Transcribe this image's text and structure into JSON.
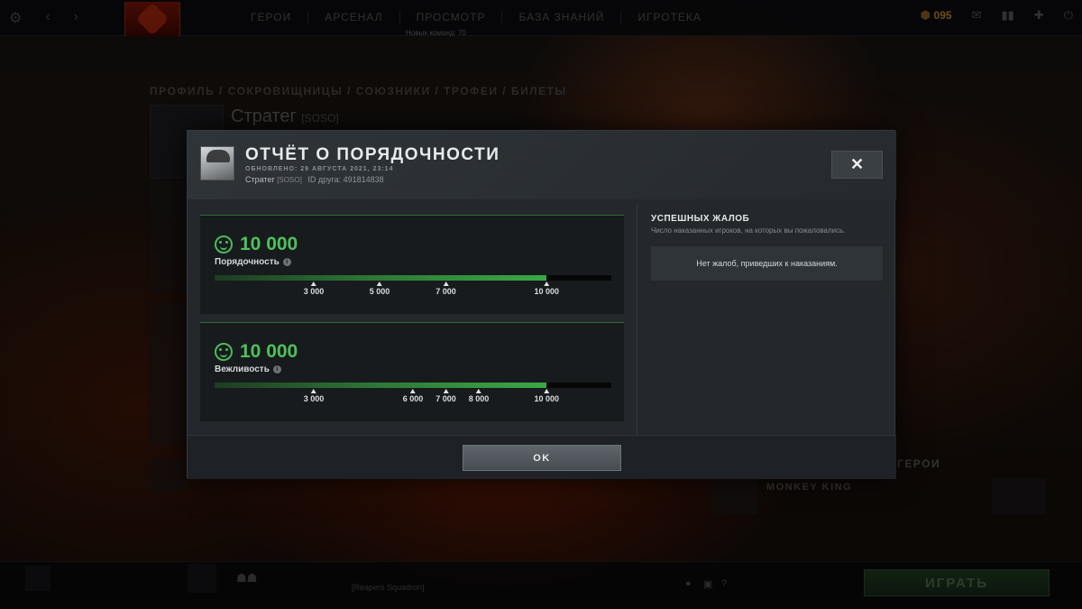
{
  "topbar": {
    "nav": [
      "ГЕРОИ",
      "АРСЕНАЛ",
      "ПРОСМОТР",
      "БАЗА ЗНАНИЙ",
      "ИГРОТЕКА"
    ],
    "new_command": "Новых команд: 70",
    "shards": "095",
    "notification_count": "1"
  },
  "background": {
    "breadcrumbs": "ПРОФИЛЬ / СОКРОВИЩНИЦЫ / СОЮЗНИКИ / ТРОФЕИ / БИЛЕТЫ",
    "profile_name": "Стратег",
    "profile_tag": "[SOSO]",
    "monkey_king": "MONKEY KING",
    "heroes": "ГЕРОИ",
    "reapers": "[Reapers Squadron]",
    "play_button": "ИГРАТЬ"
  },
  "modal": {
    "title": "ОТЧЁТ О ПОРЯДОЧНОСТИ",
    "updated": "ОБНОВЛЕНО: 29 АВГУСТА 2021, 23:14",
    "player_name": "Стратег",
    "player_tag": "[SOSO]",
    "friend_id": "ID друга: 491814838",
    "close_label": "✕",
    "ok_label": "OK",
    "cards": [
      {
        "score": "10 000",
        "label": "Порядочность",
        "fill_fraction": 0.837,
        "ticks": [
          {
            "value": "3 000",
            "pos": 0.25
          },
          {
            "value": "5 000",
            "pos": 0.416
          },
          {
            "value": "7 000",
            "pos": 0.583
          },
          {
            "value": "10 000",
            "pos": 0.837
          }
        ]
      },
      {
        "score": "10 000",
        "label": "Вежливость",
        "fill_fraction": 0.837,
        "ticks": [
          {
            "value": "3 000",
            "pos": 0.25
          },
          {
            "value": "6 000",
            "pos": 0.5
          },
          {
            "value": "7 000",
            "pos": 0.583
          },
          {
            "value": "8 000",
            "pos": 0.666
          },
          {
            "value": "10 000",
            "pos": 0.837
          }
        ]
      }
    ],
    "reports": {
      "title": "УСПЕШНЫХ ЖАЛОБ",
      "description": "Число наказанных игроков, на которых вы пожаловались.",
      "empty": "Нет жалоб, приведших к наказаниям."
    }
  },
  "colors": {
    "accent_green": "#4fc15a",
    "modal_bg": "#24282c"
  }
}
